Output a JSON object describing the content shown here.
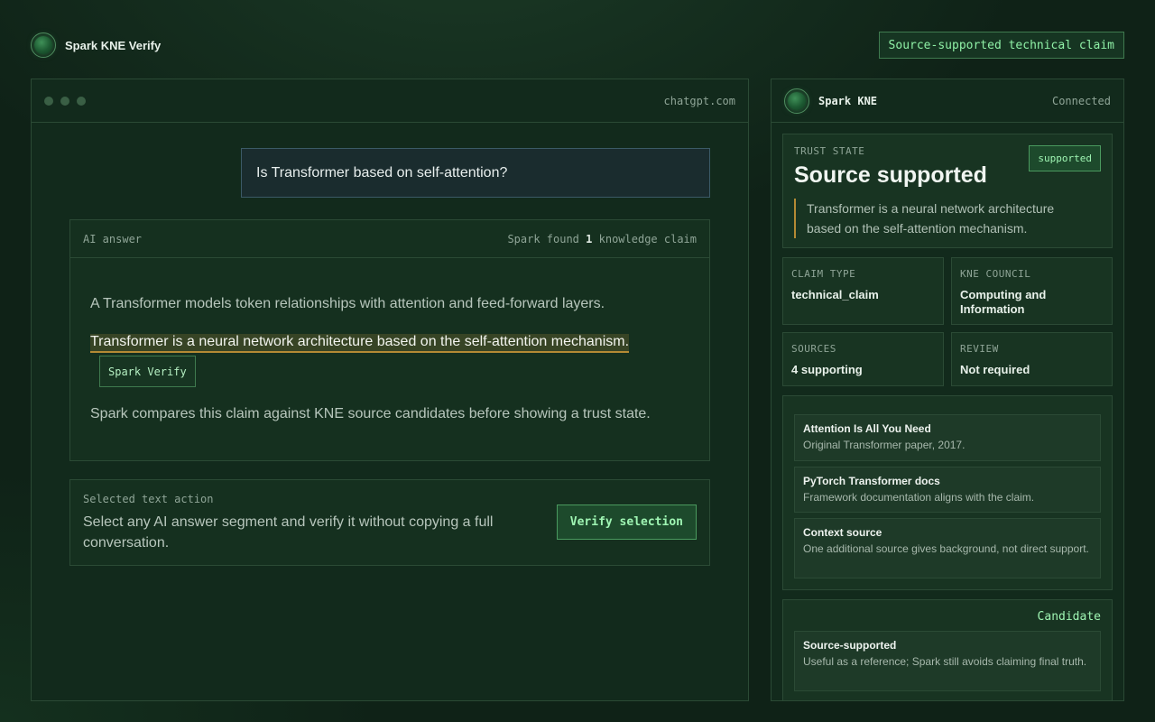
{
  "app": {
    "brand": "Spark KNE Verify",
    "top_badge": "Source-supported technical claim"
  },
  "browser": {
    "url": "chatgpt.com",
    "question": "Is Transformer based on self-attention?",
    "answer": {
      "label": "AI answer",
      "found_prefix": "Spark found",
      "found_count": "1",
      "found_suffix": "knowledge claim",
      "paragraph_1": "A Transformer models token relationships with attention and feed-forward layers.",
      "highlight": "Transformer is a neural network architecture based on the self-attention mechanism.",
      "spark_verify_label": "Spark Verify",
      "paragraph_3": "Spark compares this claim against KNE source candidates before showing a trust state."
    },
    "selected": {
      "label": "Selected text action",
      "text": "Select any AI answer segment and verify it without copying a full conversation.",
      "button": "Verify selection"
    }
  },
  "side": {
    "name": "Spark KNE",
    "status": "Connected",
    "trust": {
      "label": "TRUST STATE",
      "title": "Source supported",
      "badge": "supported",
      "quote": "Transformer is a neural network architecture based on the self-attention mechanism."
    },
    "meta": [
      {
        "label": "CLAIM TYPE",
        "value": "technical_claim"
      },
      {
        "label": "KNE COUNCIL",
        "value": "Computing and Information"
      },
      {
        "label": "SOURCES",
        "value": "4 supporting"
      },
      {
        "label": "REVIEW",
        "value": "Not required"
      }
    ],
    "sources": [
      {
        "title": "Attention Is All You Need",
        "desc": "Original Transformer paper, 2017."
      },
      {
        "title": "PyTorch Transformer docs",
        "desc": "Framework documentation aligns with the claim."
      },
      {
        "title": "Context source",
        "desc": "One additional source gives background, not direct support."
      }
    ],
    "candidate": {
      "label": "Candidate",
      "title": "Source-supported",
      "desc": "Useful as a reference; Spark still avoids claiming final truth."
    }
  },
  "colors": {
    "background": "#0f2217",
    "accent": "#9ff5b3",
    "highlight_underline": "#b48a34"
  }
}
